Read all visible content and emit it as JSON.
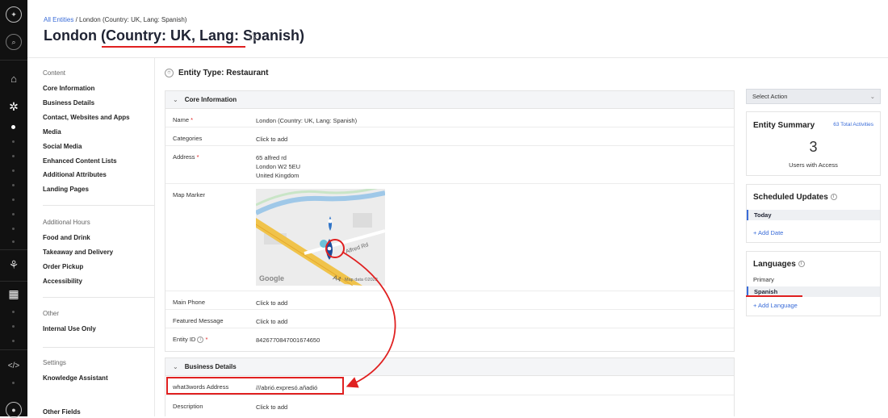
{
  "breadcrumb": {
    "root": "All Entities",
    "current": "London (Country: UK, Lang: Spanish)"
  },
  "page": {
    "title": "London (Country: UK, Lang: Spanish)"
  },
  "left_nav": {
    "content_heading": "Content",
    "content_items": [
      "Core Information",
      "Business Details",
      "Contact, Websites and Apps",
      "Media",
      "Social Media",
      "Enhanced Content Lists",
      "Additional Attributes",
      "Landing Pages"
    ],
    "hours_heading": "Additional Hours",
    "hours_items": [
      "Food and Drink",
      "Takeaway and Delivery",
      "Order Pickup",
      "Accessibility"
    ],
    "other_heading": "Other",
    "other_items": [
      "Internal Use Only"
    ],
    "settings_heading": "Settings",
    "settings_items": [
      "Knowledge Assistant"
    ],
    "other_fields": "Other Fields"
  },
  "entity_type": "Entity Type: Restaurant",
  "core": {
    "heading": "Core Information",
    "name_label": "Name",
    "name_value": "London (Country: UK, Lang: Spanish)",
    "categories_label": "Categories",
    "categories_value": "Click to add",
    "address_label": "Address",
    "address_line1": "65 alfred rd",
    "address_line2": "London W2 5EU",
    "address_line3": "United Kingdom",
    "map_label": "Map Marker",
    "map_street": "Alfred Rd",
    "map_road": "A4",
    "map_logo": "Google",
    "map_credit": "Map data ©2022",
    "phone_label": "Main Phone",
    "phone_value": "Click to add",
    "featured_label": "Featured Message",
    "featured_value": "Click to add",
    "entityid_label": "Entity ID",
    "entityid_value": "8426770847001674650"
  },
  "business": {
    "heading": "Business Details",
    "w3w_label": "what3words Address",
    "w3w_value": "///abrió.expresó.añadió",
    "desc_label": "Description",
    "desc_value": "Click to add"
  },
  "right": {
    "select_action": "Select Action",
    "summary_title": "Entity Summary",
    "total_activities": "63 Total Activities",
    "users_count": "3",
    "users_label": "Users with Access",
    "scheduled_title": "Scheduled Updates",
    "today": "Today",
    "add_date": "+ Add Date",
    "languages_title": "Languages",
    "primary": "Primary",
    "spanish": "Spanish",
    "add_language": "+ Add Language"
  },
  "colors": {
    "accent": "#3a6cd8",
    "annotation_red": "#e02020",
    "rail": "#111111"
  }
}
